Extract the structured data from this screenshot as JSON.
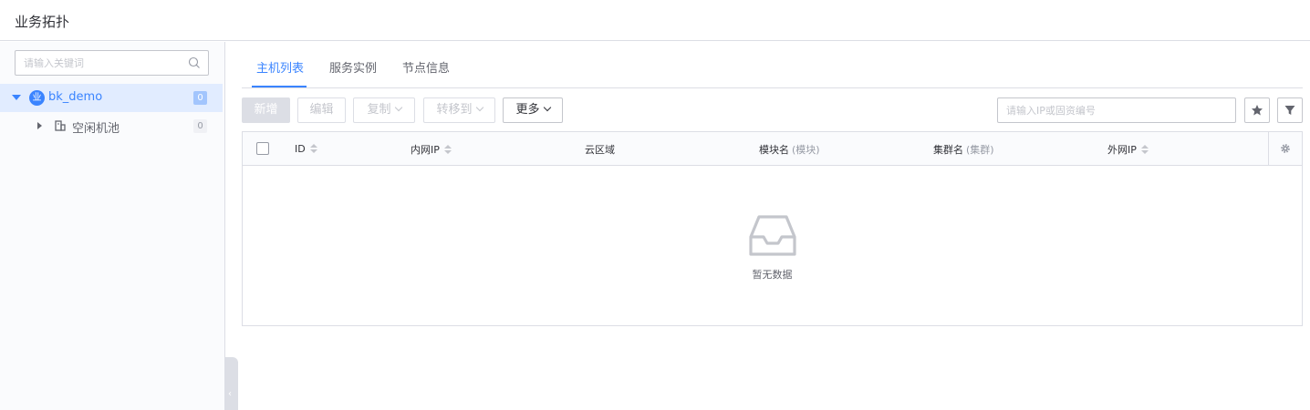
{
  "header": {
    "title": "业务拓扑"
  },
  "sidebar": {
    "search_placeholder": "请输入关键词",
    "tree": {
      "root": {
        "icon_text": "业",
        "label": "bk_demo",
        "count": "0"
      },
      "children": [
        {
          "label": "空闲机池",
          "count": "0"
        }
      ]
    }
  },
  "main": {
    "tabs": [
      {
        "label": "主机列表",
        "active": true
      },
      {
        "label": "服务实例",
        "active": false
      },
      {
        "label": "节点信息",
        "active": false
      }
    ],
    "toolbar": {
      "add_label": "新增",
      "edit_label": "编辑",
      "copy_label": "复制",
      "transfer_label": "转移到",
      "more_label": "更多",
      "ip_search_placeholder": "请输入IP或固资编号"
    },
    "table": {
      "columns": [
        {
          "label": "ID",
          "sub": "",
          "sortable": true
        },
        {
          "label": "内网IP",
          "sub": "",
          "sortable": true
        },
        {
          "label": "云区域",
          "sub": "",
          "sortable": false
        },
        {
          "label": "模块名",
          "sub": "(模块)",
          "sortable": false
        },
        {
          "label": "集群名",
          "sub": "(集群)",
          "sortable": false
        },
        {
          "label": "外网IP",
          "sub": "",
          "sortable": true
        }
      ],
      "empty_text": "暂无数据"
    }
  },
  "colors": {
    "accent": "#3a84ff",
    "border": "#dcdee5",
    "text": "#63656e"
  }
}
